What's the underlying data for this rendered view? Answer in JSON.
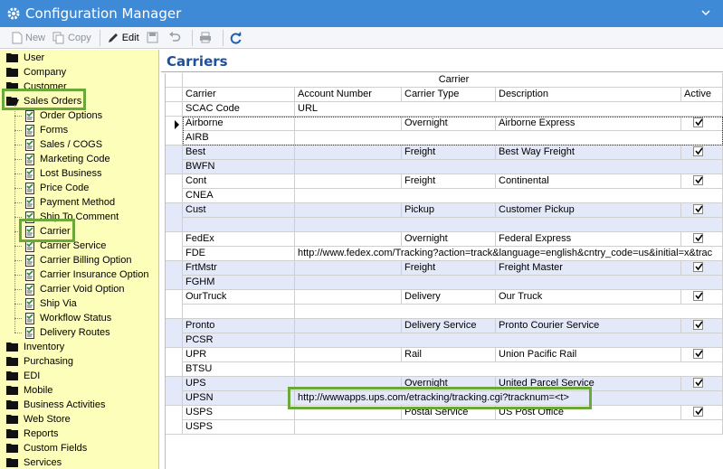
{
  "window": {
    "title": "Configuration Manager"
  },
  "toolbar": {
    "new_label": "New",
    "copy_label": "Copy",
    "edit_label": "Edit"
  },
  "sidebar": {
    "top_items": [
      {
        "label": "User"
      },
      {
        "label": "Company"
      },
      {
        "label": "Customer"
      },
      {
        "label": "Sales Orders"
      }
    ],
    "sales_order_children": [
      {
        "label": "Order Options"
      },
      {
        "label": "Forms"
      },
      {
        "label": "Sales / COGS"
      },
      {
        "label": "Marketing Code"
      },
      {
        "label": "Lost Business"
      },
      {
        "label": "Price Code"
      },
      {
        "label": "Payment Method"
      },
      {
        "label": "Ship To Comment"
      },
      {
        "label": "Carrier"
      },
      {
        "label": "Carrier Service"
      },
      {
        "label": "Carrier Billing Option"
      },
      {
        "label": "Carrier Insurance Option"
      },
      {
        "label": "Carrier Void Option"
      },
      {
        "label": "Ship Via"
      },
      {
        "label": "Workflow Status"
      },
      {
        "label": "Delivery Routes"
      }
    ],
    "bottom_items": [
      {
        "label": "Inventory"
      },
      {
        "label": "Purchasing"
      },
      {
        "label": "EDI"
      },
      {
        "label": "Mobile"
      },
      {
        "label": "Business Activities"
      },
      {
        "label": "Web Store"
      },
      {
        "label": "Reports"
      },
      {
        "label": "Custom Fields"
      },
      {
        "label": "Services"
      }
    ]
  },
  "main": {
    "title": "Carriers",
    "band_header": "Carrier",
    "columns": [
      "Carrier",
      "Account Number",
      "Carrier Type",
      "Description",
      "Active"
    ],
    "sub_columns": [
      "SCAC Code",
      "URL"
    ],
    "rows": [
      {
        "carrier": "Airborne",
        "account": "",
        "type": "Overnight",
        "description": "Airborne Express",
        "active": true,
        "scac": "AIRB",
        "url": ""
      },
      {
        "carrier": "Best",
        "account": "",
        "type": "Freight",
        "description": "Best Way Freight",
        "active": true,
        "scac": "BWFN",
        "url": ""
      },
      {
        "carrier": "Cont",
        "account": "",
        "type": "Freight",
        "description": "Continental",
        "active": true,
        "scac": "CNEA",
        "url": ""
      },
      {
        "carrier": "Cust",
        "account": "",
        "type": "Pickup",
        "description": "Customer Pickup",
        "active": true,
        "scac": "",
        "url": ""
      },
      {
        "carrier": "FedEx",
        "account": "",
        "type": "Overnight",
        "description": "Federal Express",
        "active": true,
        "scac": "FDE",
        "url": "http://www.fedex.com/Tracking?action=track&language=english&cntry_code=us&initial=x&trac"
      },
      {
        "carrier": "FrtMstr",
        "account": "",
        "type": "Freight",
        "description": "Freight Master",
        "active": true,
        "scac": "FGHM",
        "url": ""
      },
      {
        "carrier": "OurTruck",
        "account": "",
        "type": "Delivery",
        "description": "Our Truck",
        "active": true,
        "scac": "",
        "url": ""
      },
      {
        "carrier": "Pronto",
        "account": "",
        "type": "Delivery Service",
        "description": "Pronto Courier Service",
        "active": true,
        "scac": "PCSR",
        "url": ""
      },
      {
        "carrier": "UPR",
        "account": "",
        "type": "Rail",
        "description": "Union Pacific Rail",
        "active": true,
        "scac": "BTSU",
        "url": ""
      },
      {
        "carrier": "UPS",
        "account": "",
        "type": "Overnight",
        "description": "United Parcel Service",
        "active": true,
        "scac": "UPSN",
        "url": "http://wwwapps.ups.com/etracking/tracking.cgi?tracknum=<t>"
      },
      {
        "carrier": "USPS",
        "account": "",
        "type": "Postal Service",
        "description": "US Post Office",
        "active": true,
        "scac": "USPS",
        "url": ""
      }
    ]
  },
  "colors": {
    "titlebar": "#3f8ad6",
    "sidebar_bg": "#fefebb",
    "highlight_green": "#6aa83a",
    "title_blue": "#1f4e9a",
    "band_row": "#e4e9fa"
  }
}
